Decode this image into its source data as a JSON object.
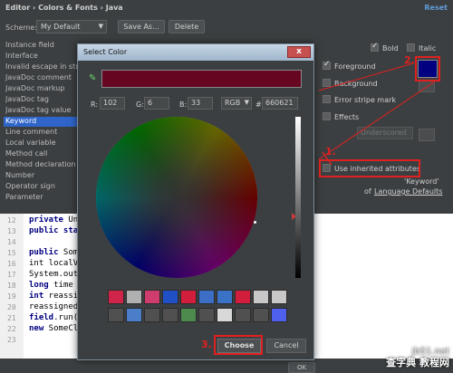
{
  "header": {
    "breadcrumb": "Editor › Colors & Fonts › Java",
    "reset": "Reset"
  },
  "scheme": {
    "label": "Scheme:",
    "value": "My Default",
    "save_as": "Save As...",
    "delete": "Delete"
  },
  "attributes": [
    "Instance field",
    "Interface",
    "Invalid escape in string",
    "JavaDoc comment",
    "JavaDoc markup",
    "JavaDoc tag",
    "JavaDoc tag value",
    "Keyword",
    "Line comment",
    "Local variable",
    "Method call",
    "Method declaration",
    "Number",
    "Operator sign",
    "Parameter"
  ],
  "selected_attribute": "Keyword",
  "options": {
    "bold": "Bold",
    "italic": "Italic",
    "foreground": "Foreground",
    "background": "Background",
    "error_stripe": "Error stripe mark",
    "effects": "Effects",
    "effects_value": "Underscored",
    "inherit": "Use inherited attributes",
    "inherit_from": "'Keyword'",
    "inherit_of": "of",
    "inherit_link": "Language Defaults"
  },
  "editor_lines": [
    {
      "n": "12",
      "kw": "private",
      "rest": " Unkn"
    },
    {
      "n": "13",
      "kw": "public static",
      "rest": " i"
    },
    {
      "n": "14",
      "kw": "",
      "rest": ""
    },
    {
      "n": "15",
      "kw": "public",
      "rest": " SomeC"
    },
    {
      "n": "16",
      "kw": "",
      "rest": "  int localVar"
    },
    {
      "n": "17",
      "kw": "",
      "rest": "  System.outp"
    },
    {
      "n": "18",
      "kw": "  long",
      "rest": " time ="
    },
    {
      "n": "19",
      "kw": "  int",
      "rest": " reassigne"
    },
    {
      "n": "20",
      "kw": "",
      "rest": "  reassignedV"
    },
    {
      "n": "21",
      "kw": "  field",
      "rest": ".run();"
    },
    {
      "n": "22",
      "kw": "  new",
      "rest": " SomeCl"
    },
    {
      "n": "23",
      "kw": "",
      "rest": ""
    }
  ],
  "dialog": {
    "title": "Select Color",
    "close": "x",
    "r_label": "R:",
    "r_value": "102",
    "g_label": "G:",
    "g_value": "6",
    "b_label": "B:",
    "b_value": "33",
    "mode": "RGB",
    "hash": "#",
    "hex": "660621",
    "choose": "Choose",
    "cancel": "Cancel"
  },
  "colors": {
    "selected": "#660621",
    "foreground": "#000080",
    "swatches_row1": [
      "#d1244a",
      "#b0b0b0",
      "#cf3c6e",
      "#2150c6",
      "#d11e3c",
      "#3b6ec4",
      "#3a72c6",
      "#d11e3c",
      "#c8c8c8",
      "#c8c8c8"
    ],
    "swatches_row2": [
      "#505050",
      "#4a7ec8",
      "#505050",
      "#505050",
      "#4e8a4e",
      "#505050",
      "#d8d8d8",
      "#505050",
      "#505050",
      "#5060ee"
    ]
  },
  "annotations": {
    "step1": "1.",
    "step2": "2.",
    "step3": "3."
  },
  "bottom": {
    "ok": "OK"
  },
  "watermark": {
    "line1": "jb51.net",
    "line2": "查字典 教程网"
  }
}
